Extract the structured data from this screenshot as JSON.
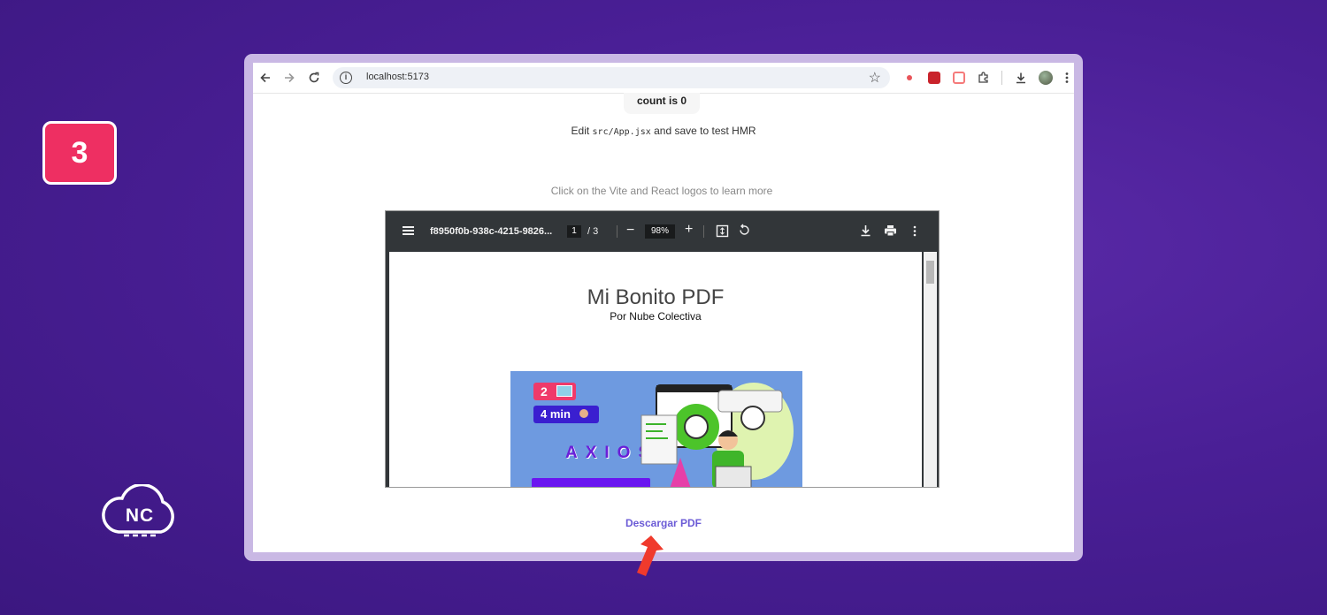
{
  "step_badge": "3",
  "brand": {
    "logo_text": "NC"
  },
  "browser": {
    "url": "localhost:5173",
    "icons": [
      "back-icon",
      "forward-icon",
      "reload-icon",
      "info-icon",
      "star-icon",
      "extension-icon",
      "download-icon",
      "profile-avatar",
      "more-icon"
    ]
  },
  "app": {
    "count_button": "count is 0",
    "edit_prefix": "Edit ",
    "edit_code": "src/App.jsx",
    "edit_suffix": " and save to test HMR",
    "read_docs": "Click on the Vite and React logos to learn more",
    "download_link": "Descargar PDF"
  },
  "pdf_viewer": {
    "filename": "f8950f0b-938c-4215-9826...",
    "current_page": "1",
    "total_pages": "/ 3",
    "zoom": "98%",
    "document": {
      "title": "Mi Bonito PDF",
      "subtitle": "Por Nube Colectiva",
      "thumbnail": {
        "badge_images": "2",
        "badge_time": "4 min",
        "heading": "AXIOS"
      }
    }
  },
  "colors": {
    "background": "#4a1f96",
    "badge": "#ee2f62",
    "link": "#6b5bd6",
    "pdf_toolbar": "#323639",
    "arrow": "#f03a2c"
  }
}
